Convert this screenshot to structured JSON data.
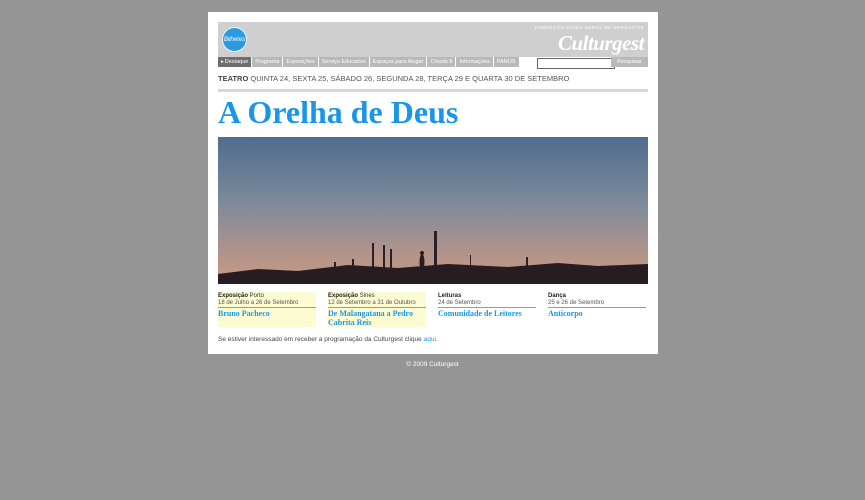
{
  "header": {
    "badge_label": "Bilhetes",
    "foundation_text": "FUNDAÇÃO CAIXA GERAL DE DEPÓSITOS",
    "logo_text": "Culturgest"
  },
  "nav": {
    "items": [
      "Destaque",
      "Programa",
      "Exposições",
      "Serviço Educativo",
      "Espaços para Alugar",
      "Chiado 8",
      "Informações",
      "PANOS"
    ],
    "search_button": "Pesquisar",
    "search_value": ""
  },
  "event_subtitle": {
    "category": "TEATRO",
    "dates": " QUINTA 24, SEXTA 25, SÁBADO 26, SEGUNDA 28, TERÇA 29 E QUARTA 30 DE SETEMBRO"
  },
  "main_title": "A Orelha de Deus",
  "events": [
    {
      "category": "Exposição",
      "location": " Porto",
      "date": "18 de Julho a 26 de Setembro",
      "name": "Bruno Pacheco"
    },
    {
      "category": "Exposição",
      "location": " Sines",
      "date": "12 de Setembro a 31 de Outubro",
      "name": "De Malangatana a Pedro Cabrita Reis"
    },
    {
      "category": "Leituras",
      "location": "",
      "date": "24 de Setembro",
      "name": "Comunidade de Leitores"
    },
    {
      "category": "Dança",
      "location": "",
      "date": "25 e 26 de Setembro",
      "name": "Anticorpo"
    }
  ],
  "newsletter": {
    "text": "Se estiver interessado em receber a programação da Culturgest clique ",
    "link": "aqui",
    "end": "."
  },
  "footer": {
    "copyright": "© 2009 Culturgest"
  },
  "colors": {
    "accent": "#1a96e8",
    "background": "#959595",
    "nav": "#b9b9b9",
    "nav_active": "#6e6e6e",
    "highlight": "#fdfbd1"
  }
}
